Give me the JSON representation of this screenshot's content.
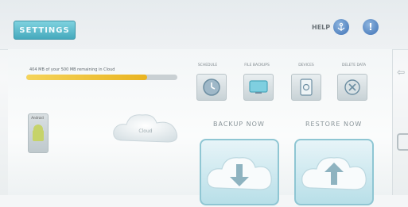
{
  "header": {
    "settings_label": "SETTINGS",
    "help_label": "HELP",
    "icon_a": "anchor-icon",
    "icon_b": "info-icon"
  },
  "storage": {
    "text": "404 MB of your 500 MB remaining in Cloud",
    "used_fraction": 0.8
  },
  "tiles": [
    {
      "label": "SCHEDULE",
      "icon": "clock-icon"
    },
    {
      "label": "FILE BACKUPS",
      "icon": "screen-icon"
    },
    {
      "label": "DEVICES",
      "icon": "device-icon"
    },
    {
      "label": "DELETE DATA",
      "icon": "delete-icon"
    }
  ],
  "device": {
    "caption": "Android"
  },
  "cloud_small": {
    "label": "Cloud"
  },
  "actions": {
    "backup_label": "BACKUP NOW",
    "restore_label": "RESTORE NOW"
  },
  "colors": {
    "accent": "#45a9bd",
    "progress": "#e9b421",
    "cloud": "#b8dfe8"
  }
}
